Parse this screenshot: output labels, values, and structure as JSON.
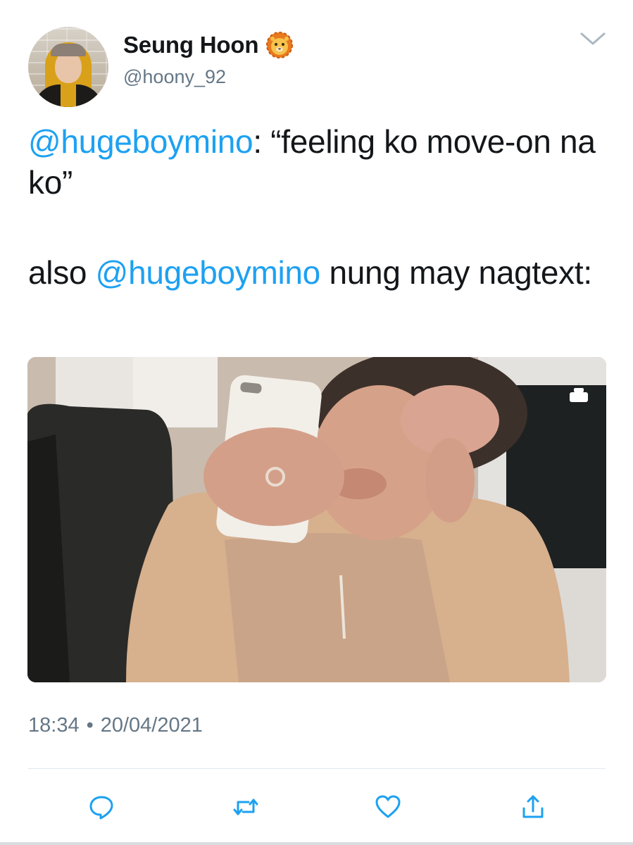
{
  "author": {
    "display_name": "Seung Hoon",
    "emoji_icon": "lion-face-icon",
    "handle": "@hoony_92",
    "avatar": "profile-photo"
  },
  "tweet": {
    "line1": {
      "mention": "@hugeboymino",
      "text": ": “feeling ko move-on na ko”"
    },
    "line2": {
      "prefix": "also ",
      "mention": "@hugeboymino",
      "text": " nung may nagtext:"
    },
    "media": {
      "type": "photo",
      "icon": "screen-recording-icon"
    }
  },
  "meta": {
    "time": "18:34",
    "separator": "•",
    "date": "20/04/2021"
  },
  "actions": {
    "reply_icon": "reply-icon",
    "retweet_icon": "retweet-icon",
    "like_icon": "heart-icon",
    "share_icon": "share-icon"
  },
  "colors": {
    "link": "#1da1f2",
    "text": "#14171a",
    "secondary": "#657786",
    "divider": "#e1e8ed"
  }
}
